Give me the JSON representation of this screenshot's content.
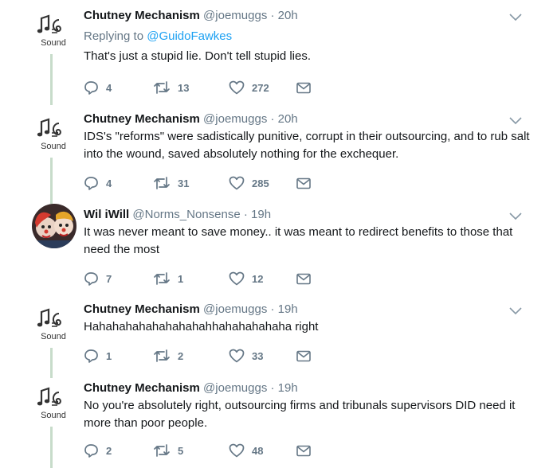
{
  "brand": {
    "accent": "#1da1f2",
    "thread_line": "#c7dcca",
    "muted": "#657786"
  },
  "tweets": [
    {
      "name": "Chutney Mechanism",
      "handle": "@joemuggs",
      "dot": "·",
      "time": "20h",
      "reply_prefix": "Replying to ",
      "reply_to": "@GuidoFawkes",
      "text": "That's just a stupid lie. Don't tell stupid lies.",
      "avatar_label": "Sound",
      "replies": "4",
      "retweets": "13",
      "likes": "272",
      "icons": {
        "reply": "reply-icon",
        "retweet": "retweet-icon",
        "like": "heart-icon",
        "dm": "envelope-icon",
        "more": "chevron-down-icon"
      }
    },
    {
      "name": "Chutney Mechanism",
      "handle": "@joemuggs",
      "dot": "·",
      "time": "20h",
      "text": "IDS's \"reforms\" were sadistically punitive, corrupt in their outsourcing, and to rub salt into the wound, saved absolutely nothing for the exchequer.",
      "avatar_label": "Sound",
      "replies": "4",
      "retweets": "31",
      "likes": "285"
    },
    {
      "name": "Wil iWill",
      "handle": "@Norms_Nonsense",
      "dot": "·",
      "time": "19h",
      "text": "It was never meant to save money.. it was meant to redirect benefits to those that need the most",
      "replies": "7",
      "retweets": "1",
      "likes": "12"
    },
    {
      "name": "Chutney Mechanism",
      "handle": "@joemuggs",
      "dot": "·",
      "time": "19h",
      "text": "Hahahahahahahahahahhahahahahaha right",
      "avatar_label": "Sound",
      "replies": "1",
      "retweets": "2",
      "likes": "33"
    },
    {
      "name": "Chutney Mechanism",
      "handle": "@joemuggs",
      "dot": "·",
      "time": "19h",
      "text": "No you're absolutely right, outsourcing firms and tribunals supervisors DID need it more than poor people.",
      "avatar_label": "Sound",
      "replies": "2",
      "retweets": "5",
      "likes": "48"
    }
  ]
}
